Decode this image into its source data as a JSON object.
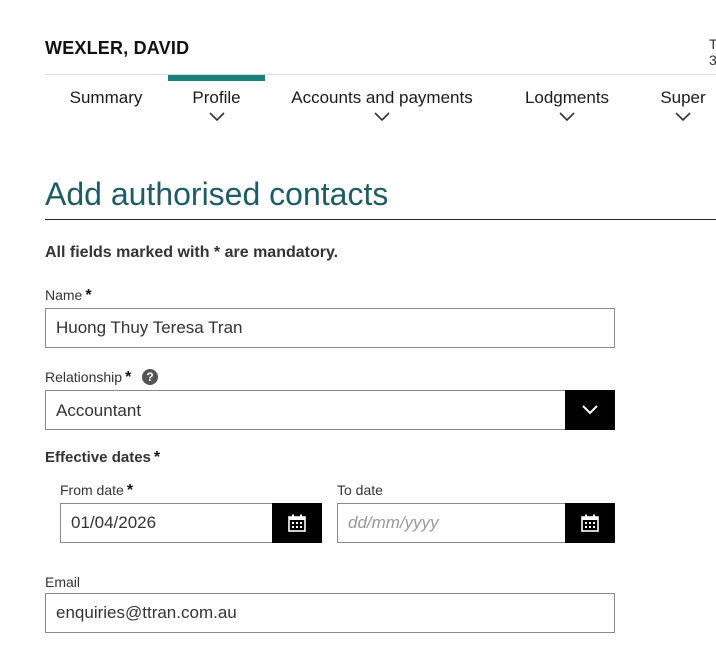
{
  "header": {
    "client_name": "WEXLER, DAVID",
    "cut_line1": "T",
    "cut_line2": "3"
  },
  "nav": {
    "items": [
      {
        "label": "Summary",
        "has_menu": false,
        "active": false
      },
      {
        "label": "Profile",
        "has_menu": true,
        "active": true
      },
      {
        "label": "Accounts and payments",
        "has_menu": true,
        "active": false
      },
      {
        "label": "Lodgments",
        "has_menu": true,
        "active": false
      },
      {
        "label": "Super",
        "has_menu": true,
        "active": false
      }
    ]
  },
  "page": {
    "title": "Add authorised contacts",
    "mandatory_note": "All fields marked with * are mandatory."
  },
  "form": {
    "required_marker": "*",
    "name": {
      "label": "Name",
      "value": "Huong Thuy Teresa Tran"
    },
    "relationship": {
      "label": "Relationship",
      "value": "Accountant",
      "help_glyph": "?"
    },
    "effective_dates": {
      "label": "Effective dates"
    },
    "from_date": {
      "label": "From date",
      "value": "01/04/2026"
    },
    "to_date": {
      "label": "To date",
      "value": "",
      "placeholder": "dd/mm/yyyy"
    },
    "email": {
      "label": "Email",
      "value": "enquiries@ttran.com.au"
    }
  },
  "colors": {
    "accent": "#1b7f7f",
    "title": "#1f5c66",
    "button": "#000000"
  },
  "icons": [
    "chevron-down-icon",
    "help-icon",
    "calendar-icon"
  ]
}
